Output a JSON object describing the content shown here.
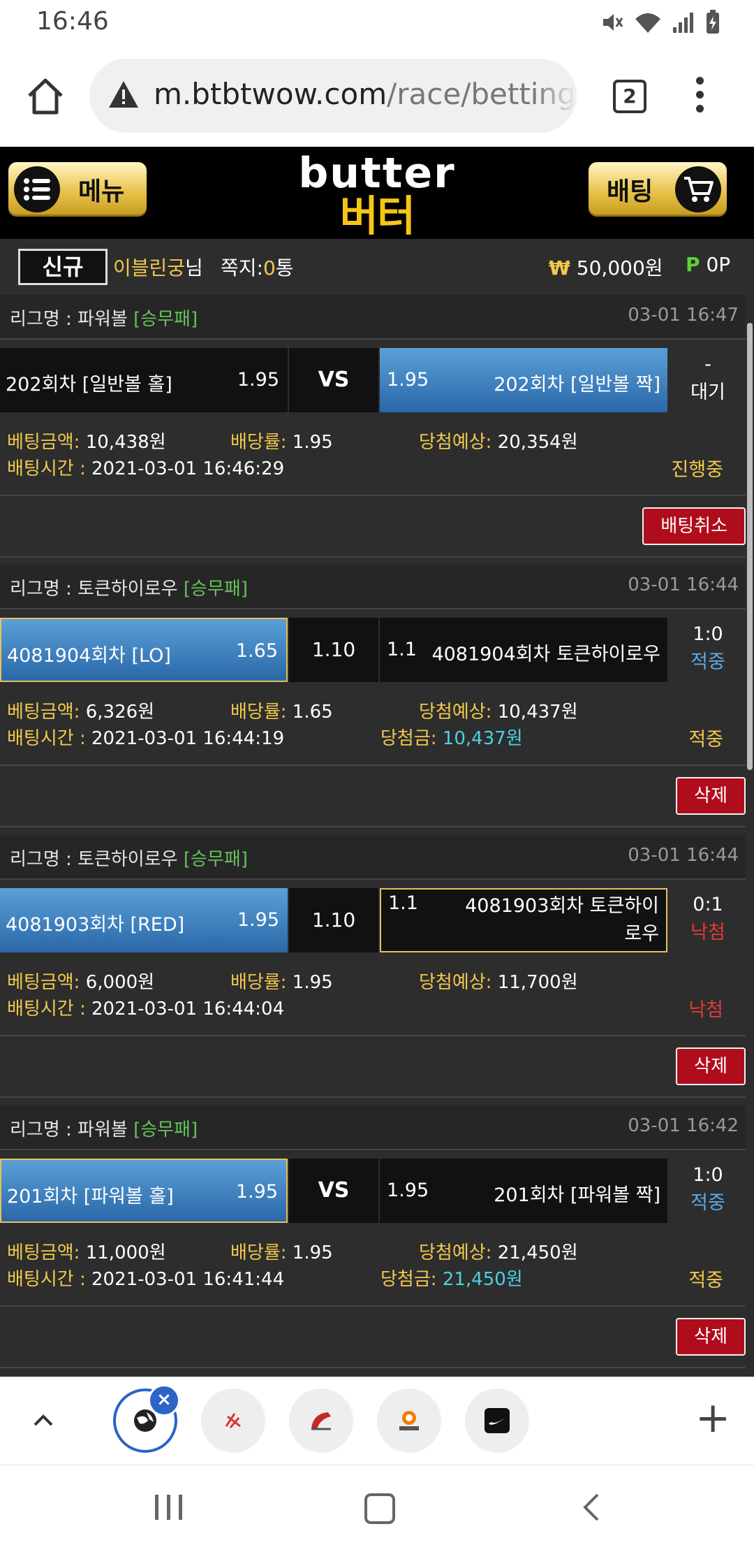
{
  "status_bar": {
    "time": "16:46"
  },
  "browser": {
    "url_host": "m.btbtwow.com",
    "url_path": "/race/betting",
    "tab_count": "2"
  },
  "site": {
    "logo_en": "butter",
    "logo_ko": "버터",
    "menu_label": "메뉴",
    "bet_label": "배팅"
  },
  "user": {
    "badge": "신규",
    "name": "이블린궁",
    "name_suffix": "님",
    "msg_label": "쪽지:",
    "msg_count": "0",
    "msg_unit": "통",
    "money_symbol": "₩",
    "money": "50,000원",
    "points_symbol": "P",
    "points": "0P"
  },
  "bets": [
    {
      "league_label": "리그명 : 파워볼",
      "type": "[승무패]",
      "date": "03-01 16:47",
      "home_team": "202회차 [일반볼 홀]",
      "home_odds": "1.95",
      "mid": "VS",
      "away_odds": "1.95",
      "away_team": "202회차 [일반볼 짝]",
      "result_score": "-",
      "result_text": "대기",
      "bet_amount_label": "베팅금액:",
      "bet_amount": "10,438원",
      "odds_label": "배당률:",
      "odds": "1.95",
      "expected_label": "당첨예상:",
      "expected": "20,354원",
      "time_label": "배팅시간 :",
      "time": "2021-03-01 16:46:29",
      "win_label": "",
      "win": "",
      "status": "진행중",
      "action": "배팅취소"
    },
    {
      "league_label": "리그명 : 토큰하이로우",
      "type": "[승무패]",
      "date": "03-01 16:44",
      "home_team": "4081904회차 [LO]",
      "home_odds": "1.65",
      "mid": "1.10",
      "away_odds": "1.1",
      "away_team": "4081904회차 토큰하이로우",
      "result_score": "1:0",
      "result_text": "적중",
      "bet_amount_label": "베팅금액:",
      "bet_amount": "6,326원",
      "odds_label": "배당률:",
      "odds": "1.65",
      "expected_label": "당첨예상:",
      "expected": "10,437원",
      "time_label": "배팅시간 :",
      "time": "2021-03-01 16:44:19",
      "win_label": "당첨금:",
      "win": "10,437원",
      "status": "적중",
      "action": "삭제"
    },
    {
      "league_label": "리그명 : 토큰하이로우",
      "type": "[승무패]",
      "date": "03-01 16:44",
      "home_team": "4081903회차 [RED]",
      "home_odds": "1.95",
      "mid": "1.10",
      "away_odds": "1.1",
      "away_team": "4081903회차 토큰하이로우",
      "result_score": "0:1",
      "result_text": "낙첨",
      "bet_amount_label": "베팅금액:",
      "bet_amount": "6,000원",
      "odds_label": "배당률:",
      "odds": "1.95",
      "expected_label": "당첨예상:",
      "expected": "11,700원",
      "time_label": "배팅시간 :",
      "time": "2021-03-01 16:44:04",
      "win_label": "",
      "win": "",
      "status": "낙첨",
      "action": "삭제"
    },
    {
      "league_label": "리그명 : 파워볼",
      "type": "[승무패]",
      "date": "03-01 16:42",
      "home_team": "201회차 [파워볼 홀]",
      "home_odds": "1.95",
      "mid": "VS",
      "away_odds": "1.95",
      "away_team": "201회차 [파워볼 짝]",
      "result_score": "1:0",
      "result_text": "적중",
      "bet_amount_label": "베팅금액:",
      "bet_amount": "11,000원",
      "odds_label": "배당률:",
      "odds": "1.95",
      "expected_label": "당첨예상:",
      "expected": "21,450원",
      "time_label": "배팅시간 :",
      "time": "2021-03-01 16:41:44",
      "win_label": "당첨금:",
      "win": "21,450원",
      "status": "적중",
      "action": "삭제"
    }
  ],
  "colors": {
    "accent_gold": "#f2c94c",
    "selected_blue": "#2a67a8",
    "hit_blue": "#5aa9e6",
    "miss_red": "#e53935",
    "action_red": "#b00d1c",
    "league_green": "#65c35a"
  },
  "icons": {
    "status": [
      "mute-icon",
      "wifi-icon",
      "signal-icon",
      "battery-icon"
    ],
    "tabs": [
      "globe-icon",
      "sports-icon",
      "game-icon",
      "albamon-icon",
      "nike-icon"
    ]
  }
}
